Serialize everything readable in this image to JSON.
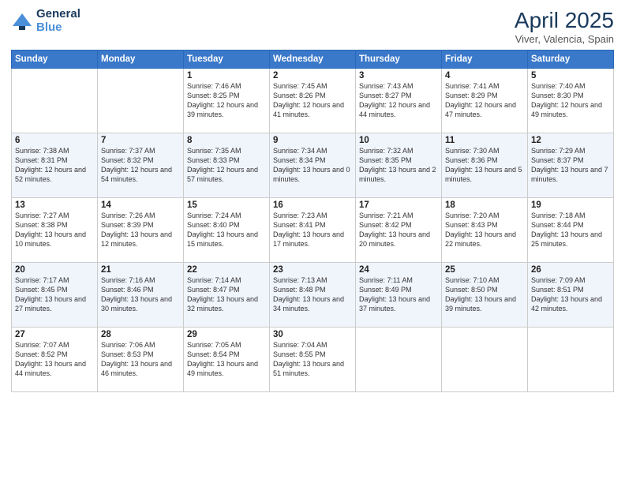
{
  "header": {
    "logo_line1": "General",
    "logo_line2": "Blue",
    "month_year": "April 2025",
    "location": "Viver, Valencia, Spain"
  },
  "days_of_week": [
    "Sunday",
    "Monday",
    "Tuesday",
    "Wednesday",
    "Thursday",
    "Friday",
    "Saturday"
  ],
  "weeks": [
    [
      {
        "day": "",
        "info": ""
      },
      {
        "day": "",
        "info": ""
      },
      {
        "day": "1",
        "info": "Sunrise: 7:46 AM\nSunset: 8:25 PM\nDaylight: 12 hours and 39 minutes."
      },
      {
        "day": "2",
        "info": "Sunrise: 7:45 AM\nSunset: 8:26 PM\nDaylight: 12 hours and 41 minutes."
      },
      {
        "day": "3",
        "info": "Sunrise: 7:43 AM\nSunset: 8:27 PM\nDaylight: 12 hours and 44 minutes."
      },
      {
        "day": "4",
        "info": "Sunrise: 7:41 AM\nSunset: 8:29 PM\nDaylight: 12 hours and 47 minutes."
      },
      {
        "day": "5",
        "info": "Sunrise: 7:40 AM\nSunset: 8:30 PM\nDaylight: 12 hours and 49 minutes."
      }
    ],
    [
      {
        "day": "6",
        "info": "Sunrise: 7:38 AM\nSunset: 8:31 PM\nDaylight: 12 hours and 52 minutes."
      },
      {
        "day": "7",
        "info": "Sunrise: 7:37 AM\nSunset: 8:32 PM\nDaylight: 12 hours and 54 minutes."
      },
      {
        "day": "8",
        "info": "Sunrise: 7:35 AM\nSunset: 8:33 PM\nDaylight: 12 hours and 57 minutes."
      },
      {
        "day": "9",
        "info": "Sunrise: 7:34 AM\nSunset: 8:34 PM\nDaylight: 13 hours and 0 minutes."
      },
      {
        "day": "10",
        "info": "Sunrise: 7:32 AM\nSunset: 8:35 PM\nDaylight: 13 hours and 2 minutes."
      },
      {
        "day": "11",
        "info": "Sunrise: 7:30 AM\nSunset: 8:36 PM\nDaylight: 13 hours and 5 minutes."
      },
      {
        "day": "12",
        "info": "Sunrise: 7:29 AM\nSunset: 8:37 PM\nDaylight: 13 hours and 7 minutes."
      }
    ],
    [
      {
        "day": "13",
        "info": "Sunrise: 7:27 AM\nSunset: 8:38 PM\nDaylight: 13 hours and 10 minutes."
      },
      {
        "day": "14",
        "info": "Sunrise: 7:26 AM\nSunset: 8:39 PM\nDaylight: 13 hours and 12 minutes."
      },
      {
        "day": "15",
        "info": "Sunrise: 7:24 AM\nSunset: 8:40 PM\nDaylight: 13 hours and 15 minutes."
      },
      {
        "day": "16",
        "info": "Sunrise: 7:23 AM\nSunset: 8:41 PM\nDaylight: 13 hours and 17 minutes."
      },
      {
        "day": "17",
        "info": "Sunrise: 7:21 AM\nSunset: 8:42 PM\nDaylight: 13 hours and 20 minutes."
      },
      {
        "day": "18",
        "info": "Sunrise: 7:20 AM\nSunset: 8:43 PM\nDaylight: 13 hours and 22 minutes."
      },
      {
        "day": "19",
        "info": "Sunrise: 7:18 AM\nSunset: 8:44 PM\nDaylight: 13 hours and 25 minutes."
      }
    ],
    [
      {
        "day": "20",
        "info": "Sunrise: 7:17 AM\nSunset: 8:45 PM\nDaylight: 13 hours and 27 minutes."
      },
      {
        "day": "21",
        "info": "Sunrise: 7:16 AM\nSunset: 8:46 PM\nDaylight: 13 hours and 30 minutes."
      },
      {
        "day": "22",
        "info": "Sunrise: 7:14 AM\nSunset: 8:47 PM\nDaylight: 13 hours and 32 minutes."
      },
      {
        "day": "23",
        "info": "Sunrise: 7:13 AM\nSunset: 8:48 PM\nDaylight: 13 hours and 34 minutes."
      },
      {
        "day": "24",
        "info": "Sunrise: 7:11 AM\nSunset: 8:49 PM\nDaylight: 13 hours and 37 minutes."
      },
      {
        "day": "25",
        "info": "Sunrise: 7:10 AM\nSunset: 8:50 PM\nDaylight: 13 hours and 39 minutes."
      },
      {
        "day": "26",
        "info": "Sunrise: 7:09 AM\nSunset: 8:51 PM\nDaylight: 13 hours and 42 minutes."
      }
    ],
    [
      {
        "day": "27",
        "info": "Sunrise: 7:07 AM\nSunset: 8:52 PM\nDaylight: 13 hours and 44 minutes."
      },
      {
        "day": "28",
        "info": "Sunrise: 7:06 AM\nSunset: 8:53 PM\nDaylight: 13 hours and 46 minutes."
      },
      {
        "day": "29",
        "info": "Sunrise: 7:05 AM\nSunset: 8:54 PM\nDaylight: 13 hours and 49 minutes."
      },
      {
        "day": "30",
        "info": "Sunrise: 7:04 AM\nSunset: 8:55 PM\nDaylight: 13 hours and 51 minutes."
      },
      {
        "day": "",
        "info": ""
      },
      {
        "day": "",
        "info": ""
      },
      {
        "day": "",
        "info": ""
      }
    ]
  ]
}
